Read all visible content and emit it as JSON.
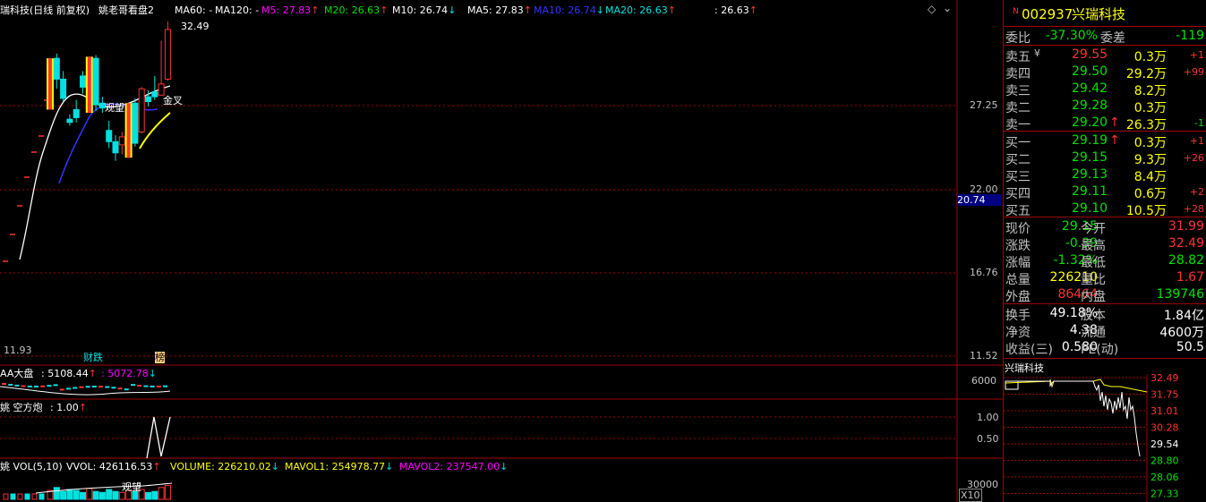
{
  "colors": {
    "up": "#ff3232",
    "down": "#00e0e0",
    "ma5": "#ffffff",
    "ma10": "#ffff00",
    "ma20": "#ff00ff",
    "blue": "#3333ff",
    "grid": "#a00000",
    "green": "#00e000",
    "yellow": "#ffff00",
    "white": "#ffffff",
    "gray": "#c0c0c0"
  },
  "main_header": {
    "title": "瑞科技(日线 前复权)",
    "indicator": "姚老哥看盘2",
    "ma60_label": "MA60: -",
    "ma120_label": "MA120: -",
    "m5": "M5: 27.83",
    "m5_arrow": "↑",
    "m20": "M20: 26.63",
    "m20_arrow": "↑",
    "m10": "M10: 26.74",
    "m10_arrow": "↓",
    "ma5": "MA5: 27.83",
    "ma5_arrow": "↑",
    "ma10": "MA10: 26.74",
    "ma10_arrow": "↓",
    "ma20": "MA20: 26.63",
    "ma20_arrow": "↑",
    "extra": ": 26.63",
    "extra_arrow": "↑"
  },
  "price_axis": {
    "ticks": [
      "27.25",
      "22.00",
      "16.76",
      "11.52"
    ],
    "highlight": "20.74"
  },
  "annotations": {
    "high": "32.49",
    "low": "11.93",
    "guanwang": "观望",
    "jincha": "金叉",
    "caidie": "财跌",
    "bang": "榜"
  },
  "panel_aa": {
    "label": "AA大盘",
    "v1": ": 5108.44",
    "v1_arrow": "↑",
    "v2": ": 5072.78",
    "v2_arrow": "↓",
    "tick": "6000"
  },
  "panel_kf": {
    "label": "姚 空方炮",
    "v": ": 1.00",
    "v_arrow": "↑",
    "ticks": [
      "1.00",
      "0.50"
    ]
  },
  "panel_vol": {
    "label": "姚 VOL(5,10)",
    "vvol": "VVOL: 426116.53",
    "vvol_arrow": "↑",
    "volume": "VOLUME: 226210.02",
    "volume_arrow": "↓",
    "mavol1": "MAVOL1: 254978.77",
    "mavol1_arrow": "↓",
    "mavol2": "MAVOL2: 237547.00",
    "mavol2_arrow": "↓",
    "tick": "30000",
    "unit": "X10",
    "guanwang": "观望"
  },
  "side": {
    "code": "002937",
    "name": "兴瑞科技",
    "badge": "N",
    "weibi_label": "委比",
    "weibi": "-37.30%",
    "weicha_label": "委差",
    "weicha": "-119",
    "asks": [
      {
        "label": "卖五",
        "mark": "¥",
        "price": "29.55",
        "vol": "0.3万",
        "chg": "+1"
      },
      {
        "label": "卖四",
        "mark": "",
        "price": "29.50",
        "vol": "29.2万",
        "chg": "+99"
      },
      {
        "label": "卖三",
        "mark": "",
        "price": "29.42",
        "vol": "8.2万",
        "chg": ""
      },
      {
        "label": "卖二",
        "mark": "",
        "price": "29.28",
        "vol": "0.3万",
        "chg": ""
      },
      {
        "label": "卖一",
        "mark": "",
        "price": "29.20",
        "arrow": "↑",
        "vol": "26.3万",
        "chg": "-1"
      }
    ],
    "bids": [
      {
        "label": "买一",
        "price": "29.19",
        "arrow": "↑",
        "vol": "0.3万",
        "chg": "+1"
      },
      {
        "label": "买二",
        "price": "29.15",
        "vol": "9.3万",
        "chg": "+26"
      },
      {
        "label": "买三",
        "price": "29.13",
        "vol": "8.4万",
        "chg": ""
      },
      {
        "label": "买四",
        "price": "29.11",
        "vol": "0.6万",
        "chg": "+2"
      },
      {
        "label": "买五",
        "price": "29.10",
        "vol": "10.5万",
        "chg": "+28"
      }
    ],
    "quote": [
      {
        "l1": "现价",
        "v1": "29.15",
        "l2": "今开",
        "v2": "31.99"
      },
      {
        "l1": "涨跌",
        "v1": "-0.39",
        "l2": "最高",
        "v2": "32.49"
      },
      {
        "l1": "涨幅",
        "v1": "-1.32%",
        "l2": "最低",
        "v2": "28.82"
      },
      {
        "l1": "总量",
        "v1": "226210",
        "l2": "量比",
        "v2": "1.67"
      },
      {
        "l1": "外盘",
        "v1": "86464",
        "l2": "内盘",
        "v2": "139746"
      }
    ],
    "stats": [
      {
        "l1": "换手",
        "v1": "49.18%",
        "l2": "股本",
        "v2": "1.84亿"
      },
      {
        "l1": "净资",
        "v1": "4.38",
        "l2": "流通",
        "v2": "4600万"
      },
      {
        "l1": "收益(三)",
        "v1": "0.580",
        "l2": "PE(动)",
        "v2": "50.5"
      }
    ],
    "mini_title": "兴瑞科技",
    "mini_ticks": [
      "32.49",
      "31.75",
      "31.01",
      "30.28",
      "29.54",
      "28.80",
      "28.06",
      "27.33"
    ]
  },
  "candles": [
    {
      "o": 27.0,
      "h": 30.2,
      "l": 27.0,
      "c": 30.2,
      "lim": true
    },
    {
      "o": 30.2,
      "h": 30.5,
      "l": 28.3,
      "c": 28.9
    },
    {
      "o": 28.9,
      "h": 29.4,
      "l": 27.5,
      "c": 27.7
    },
    {
      "o": 26.4,
      "h": 26.7,
      "l": 26.0,
      "c": 26.2
    },
    {
      "o": 27.0,
      "h": 27.6,
      "l": 26.2,
      "c": 26.5
    },
    {
      "o": 29.1,
      "h": 29.4,
      "l": 28.0,
      "c": 28.4
    },
    {
      "o": 26.8,
      "h": 30.3,
      "l": 26.8,
      "c": 30.3,
      "lim": true
    },
    {
      "o": 30.2,
      "h": 30.4,
      "l": 26.9,
      "c": 27.3
    },
    {
      "o": 27.4,
      "h": 27.8,
      "l": 26.8,
      "c": 27.1
    },
    {
      "o": 25.7,
      "h": 26.3,
      "l": 24.6,
      "c": 25.0
    },
    {
      "o": 25.0,
      "h": 25.4,
      "l": 23.8,
      "c": 24.3
    },
    {
      "o": 24.8,
      "h": 25.6,
      "l": 24.2,
      "c": 25.3
    },
    {
      "o": 24.0,
      "h": 27.4,
      "l": 24.0,
      "c": 27.4,
      "lim": true
    },
    {
      "o": 27.4,
      "h": 27.7,
      "l": 24.7,
      "c": 24.9
    },
    {
      "o": 25.6,
      "h": 28.4,
      "l": 25.5,
      "c": 28.3
    },
    {
      "o": 27.8,
      "h": 28.2,
      "l": 27.2,
      "c": 27.5
    },
    {
      "o": 28.1,
      "h": 29.1,
      "l": 27.6,
      "c": 27.8
    },
    {
      "o": 27.9,
      "h": 31.3,
      "l": 27.9,
      "c": 28.6
    },
    {
      "o": 28.9,
      "h": 32.5,
      "l": 28.8,
      "c": 32.0
    }
  ],
  "volumes": [
    9,
    12,
    8,
    10,
    9,
    7,
    11,
    8,
    7,
    10,
    8,
    7,
    9,
    8,
    10,
    7,
    8,
    12,
    14
  ]
}
